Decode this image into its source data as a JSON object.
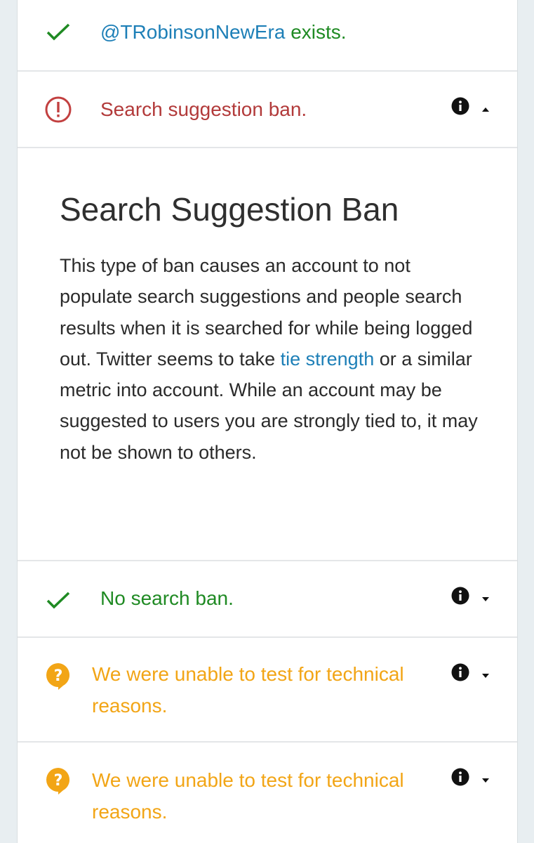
{
  "rows": {
    "exists": {
      "handle": "@TRobinsonNewEra",
      "text": " exists.",
      "icon": "checkmark-icon",
      "color": "#1f8a23"
    },
    "suggestion_ban": {
      "text": "Search suggestion ban.",
      "icon": "exclamation-circle-icon",
      "color": "#b23a3a",
      "expanded": true
    },
    "no_search_ban": {
      "text": "No search ban.",
      "icon": "checkmark-icon",
      "color": "#1f8a23",
      "expanded": false
    },
    "unable_1": {
      "line1": "We were unable to test for technical",
      "line2": "reasons.",
      "icon": "question-bubble-icon",
      "color": "#f2a516",
      "expanded": false
    },
    "unable_2": {
      "line1": "We were unable to test for technical",
      "line2": "reasons.",
      "icon": "question-bubble-icon",
      "color": "#f2a516",
      "expanded": false
    }
  },
  "panel": {
    "title": "Search Suggestion Ban",
    "body_part1": "This type of ban causes an account to not populate search suggestions and people search results when it is searched for while being logged out. Twitter seems to take ",
    "link": "tie strength",
    "body_part2": " or a similar metric into account. While an account may be suggested to users you are strongly tied to, it may not be shown to others."
  },
  "colors": {
    "link": "#1d7fb7",
    "background": "#e8eef1"
  }
}
